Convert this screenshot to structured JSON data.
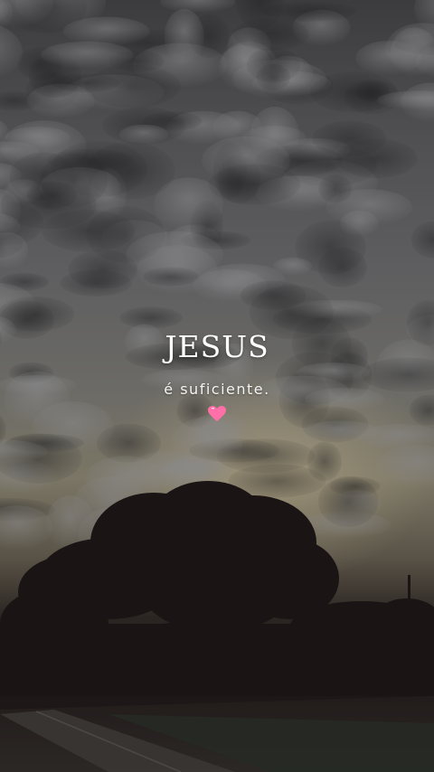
{
  "caption": {
    "title": "JESUS",
    "subtitle": "é suficiente.",
    "heart_icon": "heart-icon",
    "heart_color": "#ff6fa8"
  },
  "colors": {
    "sky_dark": "#3c3c3e",
    "sky_glow": "#b9a98a",
    "silhouette": "#1a1514"
  }
}
